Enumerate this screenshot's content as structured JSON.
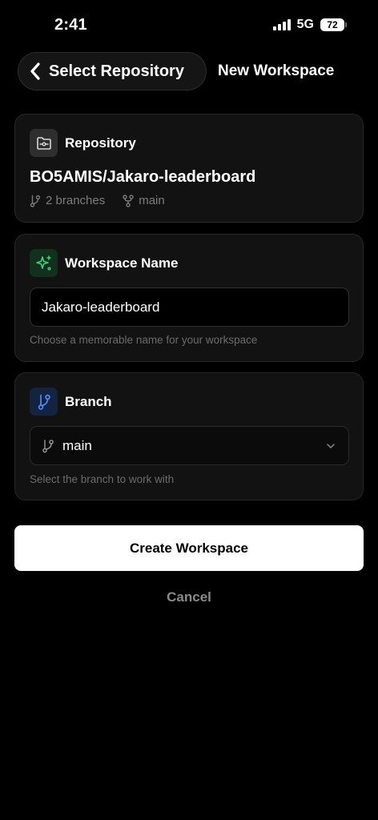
{
  "status_bar": {
    "time": "2:41",
    "network": "5G",
    "battery": "72"
  },
  "nav": {
    "back_label": "Select Repository",
    "title": "New Workspace"
  },
  "repository": {
    "title": "Repository",
    "name": "BO5AMIS/Jakaro-leaderboard",
    "branches": "2 branches",
    "default_branch": "main"
  },
  "workspace": {
    "title": "Workspace Name",
    "value": "Jakaro-leaderboard",
    "hint": "Choose a memorable name for your workspace"
  },
  "branch": {
    "title": "Branch",
    "selected": "main",
    "hint": "Select the branch to work with"
  },
  "actions": {
    "create": "Create Workspace",
    "cancel": "Cancel"
  },
  "colors": {
    "accent_green": "#3fcf7a",
    "accent_blue": "#4d8cff",
    "background": "#000000"
  },
  "icons": [
    "folder-git-icon",
    "sparkles-icon",
    "git-branch-icon",
    "git-fork-icon",
    "chevron-down-icon",
    "chevron-left-icon"
  ]
}
